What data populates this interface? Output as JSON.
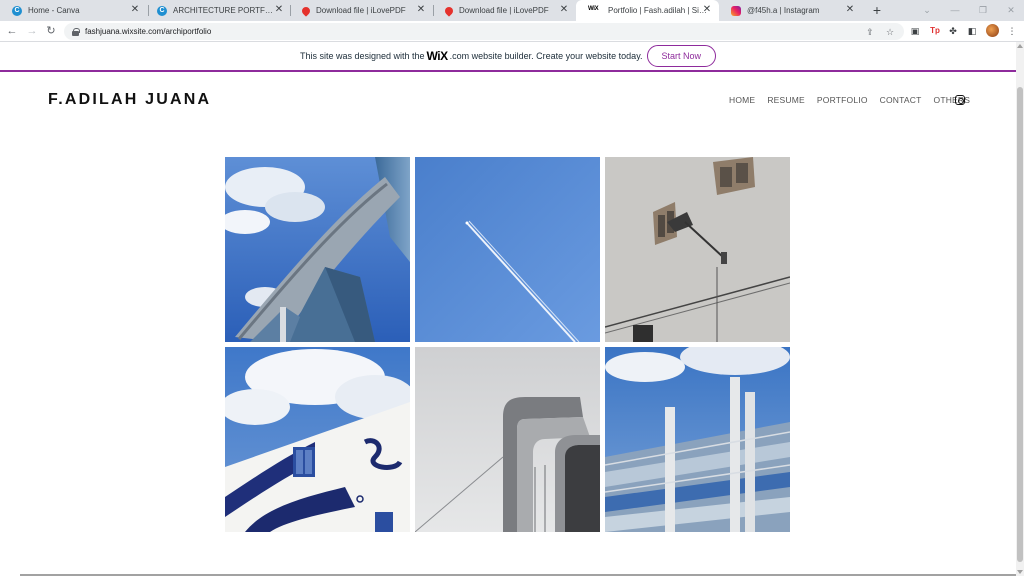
{
  "browser": {
    "tabs": [
      {
        "title": "Home - Canva",
        "favicon": "canva-icon",
        "active": false
      },
      {
        "title": "ARCHITECTURE PORTFOLIO - De",
        "favicon": "canva-icon",
        "active": false
      },
      {
        "title": "Download file | iLovePDF",
        "favicon": "ilovepdf-icon",
        "active": false
      },
      {
        "title": "Download file | iLovePDF",
        "favicon": "ilovepdf-icon",
        "active": false
      },
      {
        "title": "Portfolio | Fash.adilah | Singapor",
        "favicon": "wix-icon",
        "active": true
      },
      {
        "title": "@f45h.a | Instagram",
        "favicon": "instagram-icon",
        "active": false
      }
    ],
    "favicon_glyphs": {
      "canva": "C",
      "wix": "WiX"
    },
    "url": "fashjuana.wixsite.com/archiportfolio",
    "extension_label": "Tp"
  },
  "wix_banner": {
    "text_before": "This site was designed with the",
    "logo": "WiX",
    "text_after": ".com website builder. Create your website today.",
    "button_label": "Start Now",
    "accent_color": "#8e2b9c"
  },
  "site": {
    "logo": "F.ADILAH JUANA",
    "nav": [
      {
        "label": "HOME"
      },
      {
        "label": "RESUME"
      },
      {
        "label": "PORTFOLIO"
      },
      {
        "label": "CONTACT"
      },
      {
        "label": "OTHERS"
      }
    ],
    "social_icon": "instagram-icon"
  },
  "gallery": {
    "photos": [
      {
        "name": "photo-marina-bay-sands"
      },
      {
        "name": "photo-airplane-contrail"
      },
      {
        "name": "photo-wall-lamp"
      },
      {
        "name": "photo-blue-mural-building"
      },
      {
        "name": "photo-curved-facade"
      },
      {
        "name": "photo-glass-facade"
      }
    ]
  }
}
